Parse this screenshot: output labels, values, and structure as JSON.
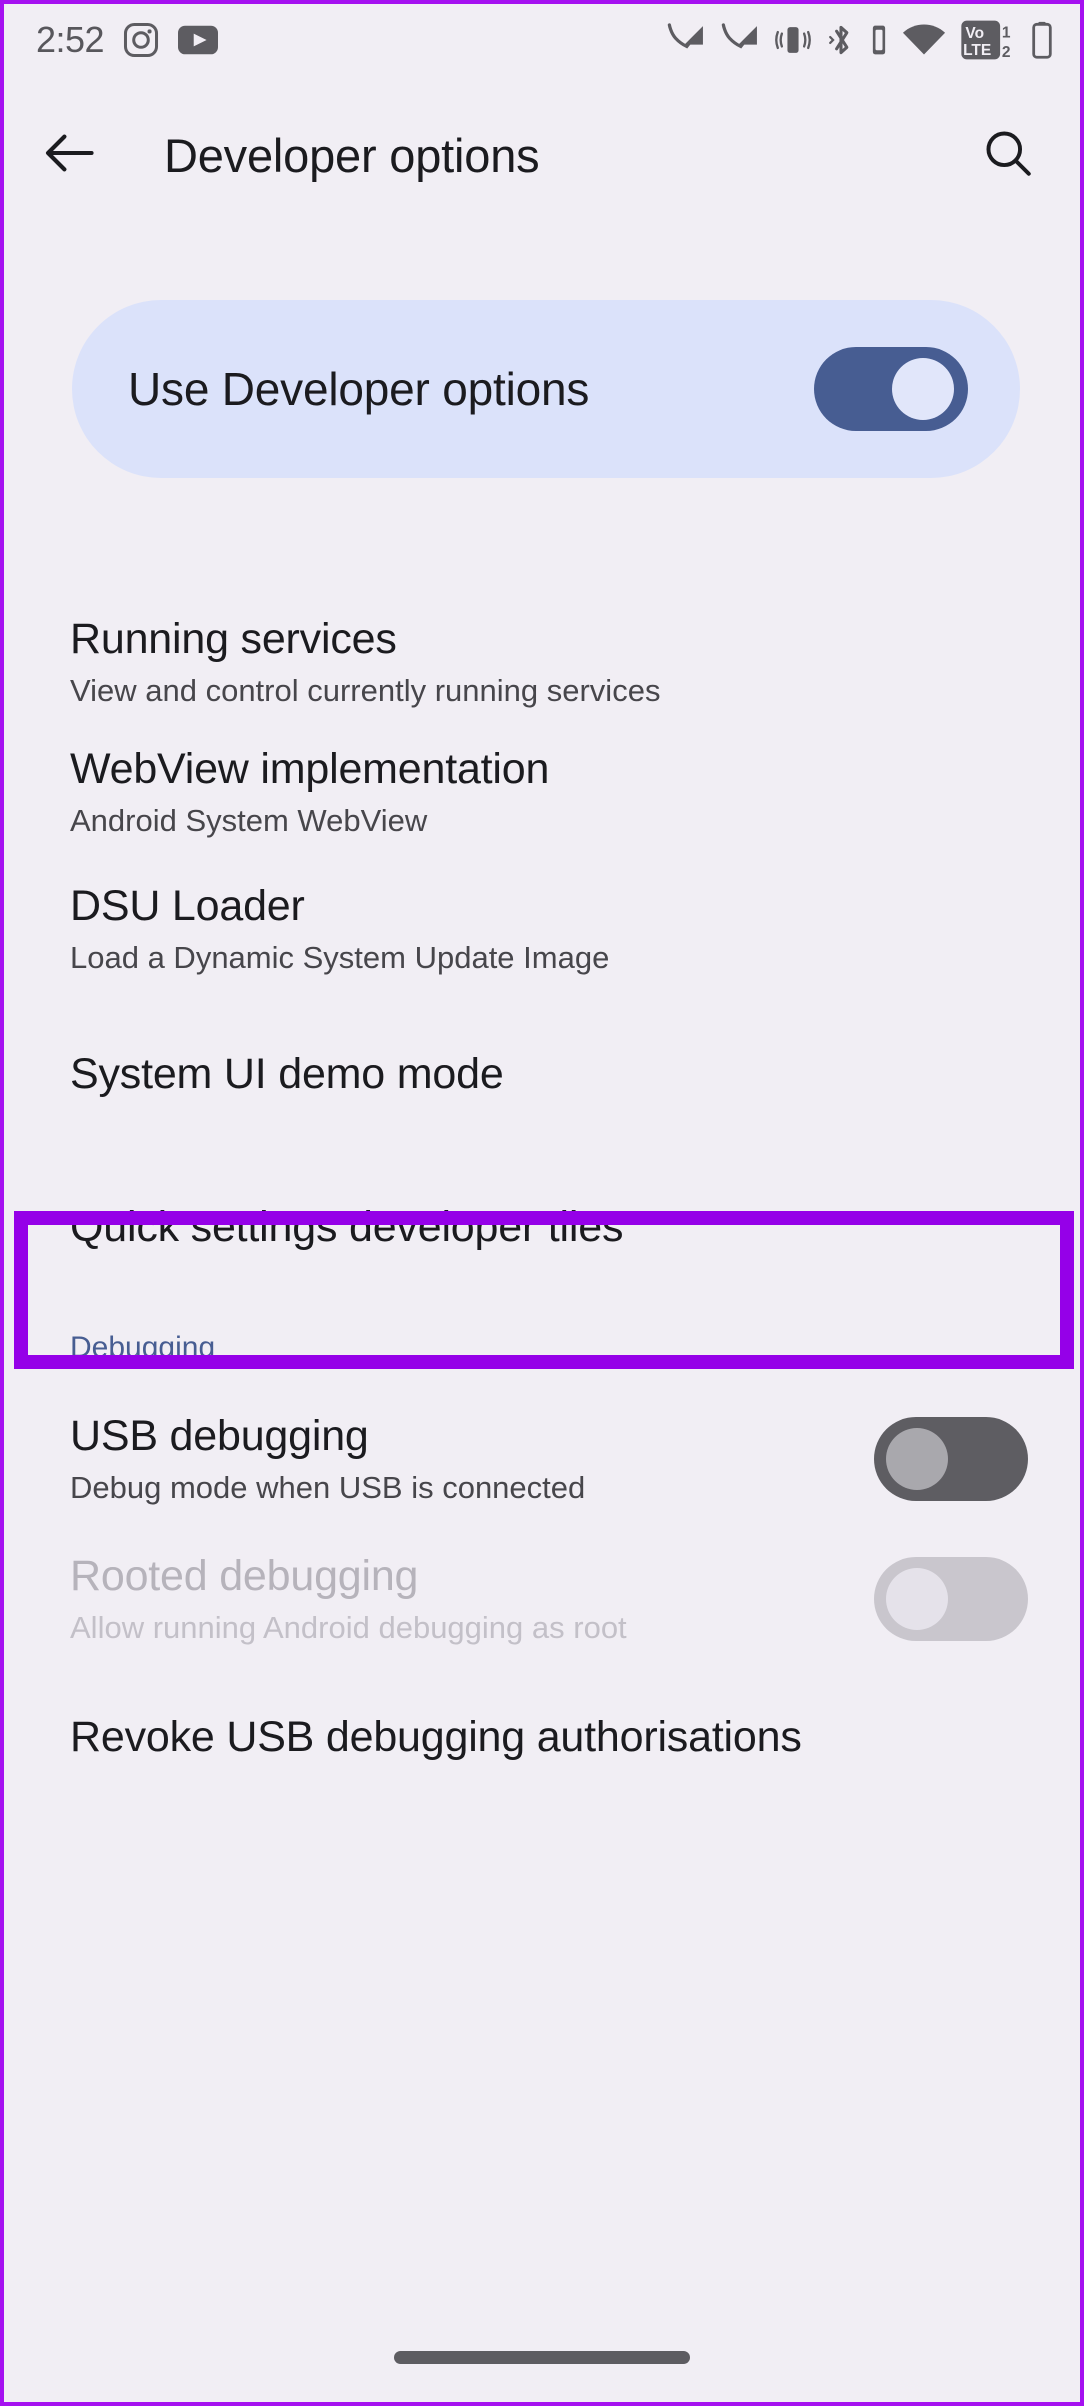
{
  "status_bar": {
    "clock": "2:52",
    "left_icons": [
      "instagram-icon",
      "youtube-icon"
    ],
    "right_icons": [
      "mobile-signal-1-icon",
      "mobile-signal-2-icon",
      "vibrate-icon",
      "bluetooth-icon",
      "bluetooth-battery-icon",
      "wifi-icon",
      "volte-dual-sim-icon",
      "battery-icon"
    ],
    "volte_label_top": "Vo",
    "volte_label_bottom": "LTE",
    "volte_sim_1": "1",
    "volte_sim_2": "2"
  },
  "app_bar": {
    "back_icon": "arrow-left-icon",
    "title": "Developer options",
    "search_icon": "search-icon"
  },
  "master_toggle": {
    "label": "Use Developer options",
    "state": "on"
  },
  "colors": {
    "page_background": "#f1eef4",
    "card_background": "#dbe2fa",
    "accent": "#475d92",
    "highlight": "#9500e8",
    "toggle_on_track": "#475d92",
    "toggle_off_track": "#5e5d62",
    "toggle_disabled_track": "#c9c6cd"
  },
  "list": [
    {
      "name": "running-services",
      "title": "Running services",
      "subtitle": "View and control currently running services",
      "control": "none",
      "disabled": false,
      "highlighted": false
    },
    {
      "name": "webview-implementation",
      "title": "WebView implementation",
      "subtitle": "Android System WebView",
      "control": "none",
      "disabled": false,
      "highlighted": false
    },
    {
      "name": "dsu-loader",
      "title": "DSU Loader",
      "subtitle": "Load a Dynamic System Update Image",
      "control": "none",
      "disabled": false,
      "highlighted": false
    },
    {
      "name": "system-ui-demo-mode",
      "title": "System UI demo mode",
      "subtitle": "",
      "control": "none",
      "disabled": false,
      "highlighted": true
    },
    {
      "name": "quick-settings-developer-tiles",
      "title": "Quick settings developer tiles",
      "subtitle": "",
      "control": "none",
      "disabled": false,
      "highlighted": false
    }
  ],
  "debugging_section": {
    "header": "Debugging",
    "items": [
      {
        "name": "usb-debugging",
        "title": "USB debugging",
        "subtitle": "Debug mode when USB is connected",
        "control": "switch",
        "switch_state": "off",
        "disabled": false
      },
      {
        "name": "rooted-debugging",
        "title": "Rooted debugging",
        "subtitle": "Allow running Android debugging as root",
        "control": "switch",
        "switch_state": "disabled",
        "disabled": true
      },
      {
        "name": "revoke-usb-debugging-authorisations",
        "title": "Revoke USB debugging authorisations",
        "subtitle": "",
        "control": "none",
        "switch_state": "",
        "disabled": false
      }
    ]
  },
  "nav_bar": {
    "gesture_pill": "home-gesture-pill"
  }
}
